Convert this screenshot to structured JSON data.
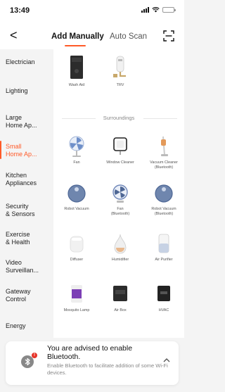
{
  "status_bar": {
    "time": "13:49"
  },
  "header": {
    "tabs": [
      "Add Manually",
      "Auto Scan"
    ]
  },
  "sidebar": {
    "items": [
      "Electrician",
      "Lighting",
      "Large\nHome Ap...",
      "Small\nHome Ap...",
      "Kitchen\nAppliances",
      "Security\n& Sensors",
      "Exercise\n& Health",
      "Video\nSurveillan...",
      "Gateway\nControl",
      "Energy"
    ],
    "active_index": 3
  },
  "devices_top": [
    "Wash Aid",
    "TRV"
  ],
  "section": {
    "title": "Surroundings"
  },
  "devices": [
    {
      "label": "Fan",
      "icon": "fan-icon"
    },
    {
      "label": "Window Cleaner",
      "icon": "window-cleaner-icon"
    },
    {
      "label": "Vacuum Cleaner\n(Bluetooth)",
      "icon": "stick-vacuum-icon"
    },
    {
      "label": "Robot Vacuum",
      "icon": "robot-vacuum-icon"
    },
    {
      "label": "Fan\n(Bluetooth)",
      "icon": "fan-icon"
    },
    {
      "label": "Robot Vacuum\n(Bluetooth)",
      "icon": "robot-vacuum-icon"
    },
    {
      "label": "Diffuser",
      "icon": "diffuser-icon"
    },
    {
      "label": "Humidifier",
      "icon": "humidifier-icon"
    },
    {
      "label": "Air Purifier",
      "icon": "air-purifier-icon"
    },
    {
      "label": "Mosquito Lamp",
      "icon": "mosquito-lamp-icon"
    },
    {
      "label": "Air Box",
      "icon": "air-box-icon"
    },
    {
      "label": "HVAC",
      "icon": "hvac-icon"
    }
  ],
  "notice": {
    "title": "You are advised to enable Bluetooth.",
    "description": "Enable Bluetooth to facilitate addition of some Wi-Fi devices.",
    "badge": "!"
  },
  "colors": {
    "accent": "#ff5a28",
    "badge": "#e63328"
  }
}
